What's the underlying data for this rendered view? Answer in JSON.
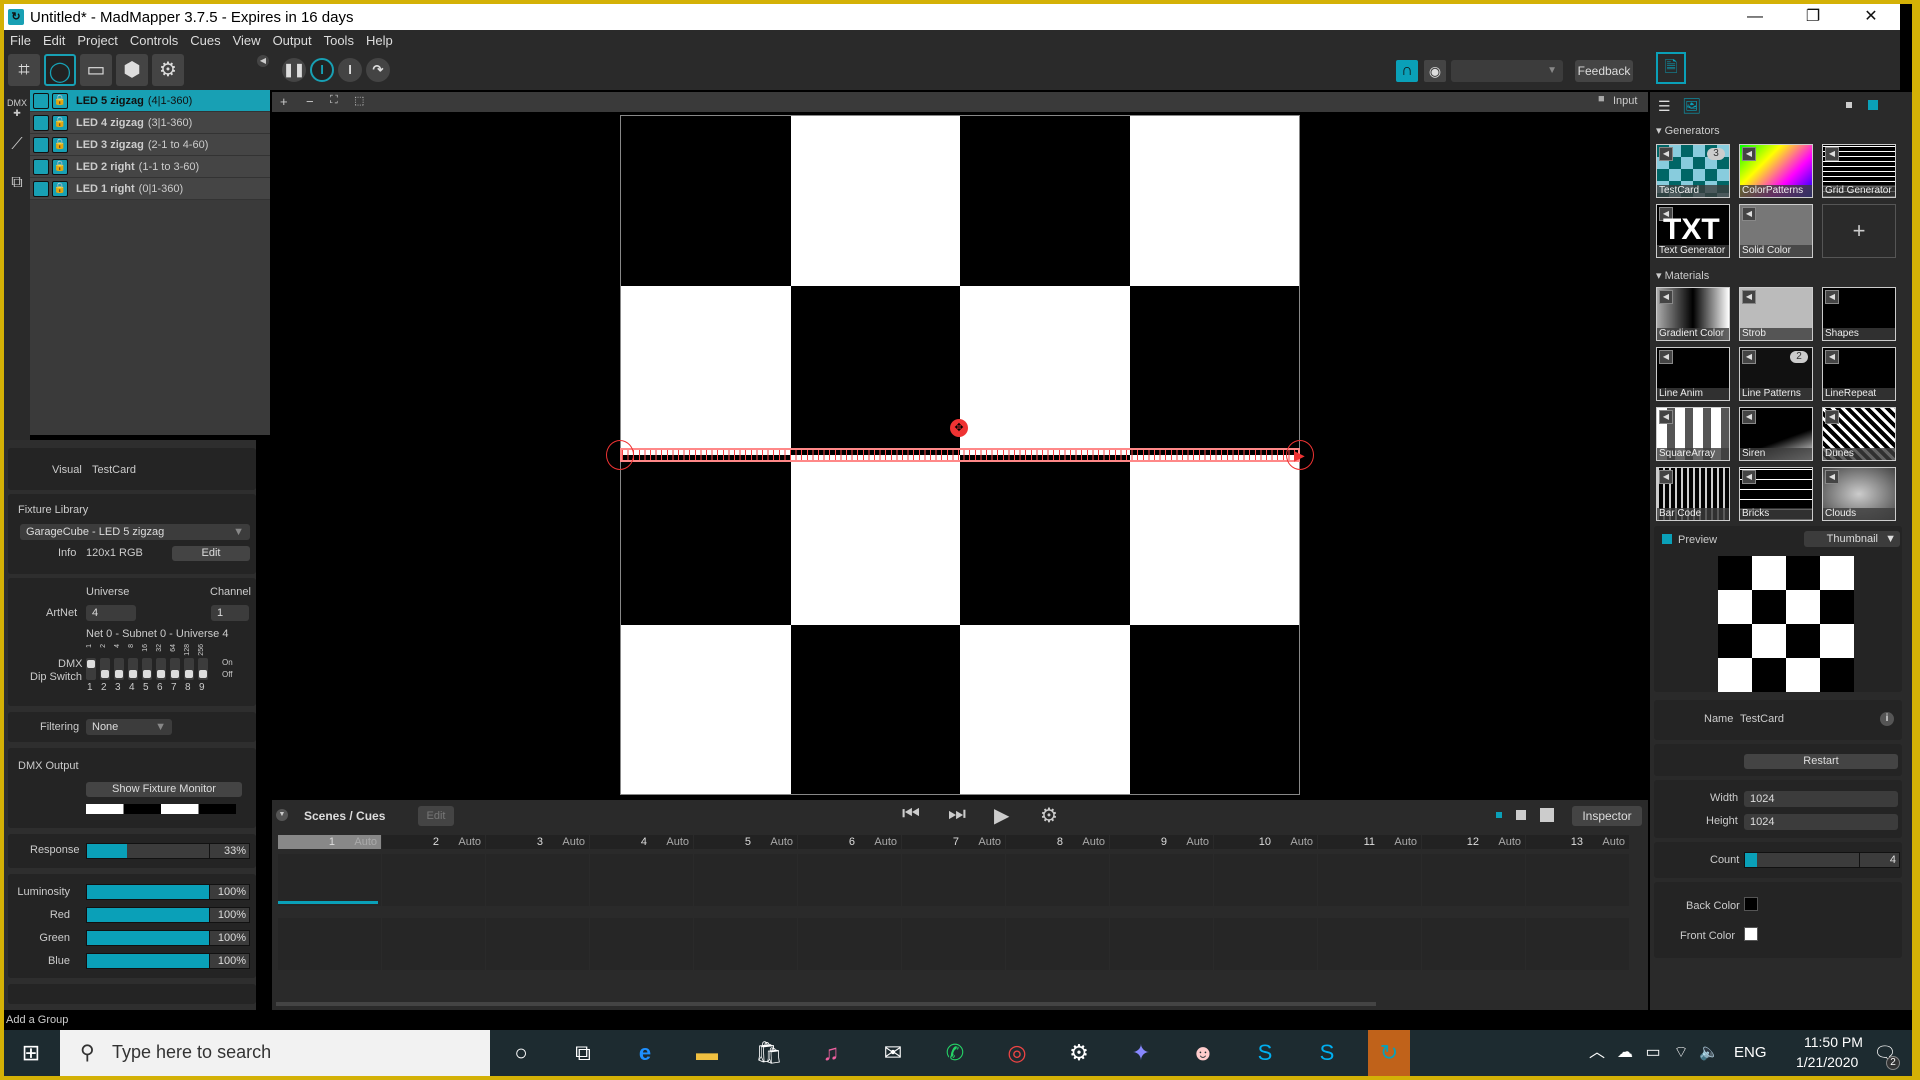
{
  "window": {
    "title": "Untitled* - MadMapper 3.7.5 - Expires in 16 days",
    "minimize": "—",
    "restore": "❐",
    "close": "✕"
  },
  "menu": [
    "File",
    "Edit",
    "Project",
    "Controls",
    "Cues",
    "View",
    "Output",
    "Tools",
    "Help"
  ],
  "toolbar": {
    "feedback_label": "Feedback",
    "input_label": "Input",
    "project_select_value": ""
  },
  "sidebar_tools": {
    "dmx_label": "DMX"
  },
  "layers": [
    {
      "name": "LED 5 zigzag",
      "detail": "(4|1-360)",
      "selected": true
    },
    {
      "name": "LED 4 zigzag",
      "detail": "(3|1-360)",
      "selected": false
    },
    {
      "name": "LED 3 zigzag",
      "detail": "(2-1 to 4-60)",
      "selected": false
    },
    {
      "name": "LED 2 right",
      "detail": "(1-1 to 3-60)",
      "selected": false
    },
    {
      "name": "LED 1 right",
      "detail": "(0|1-360)",
      "selected": false
    }
  ],
  "fixture": {
    "visual_label": "Visual",
    "visual_value": "TestCard",
    "library_label": "Fixture Library",
    "library_value": "GarageCube - LED 5 zigzag",
    "info_label": "Info",
    "info_value": "120x1 RGB",
    "edit_label": "Edit",
    "universe_label": "Universe",
    "channel_label": "Channel",
    "artnet_label": "ArtNet",
    "universe_value": "4",
    "channel_value": "1",
    "net_info": "Net 0 - Subnet 0 - Universe 4",
    "dmx_label": "DMX",
    "dip_label": "Dip Switch",
    "dip_values": [
      "1",
      "2",
      "4",
      "8",
      "16",
      "32",
      "64",
      "128",
      "256"
    ],
    "dip_numbers": [
      "1",
      "2",
      "3",
      "4",
      "5",
      "6",
      "7",
      "8",
      "9"
    ],
    "dip_on": [
      true,
      false,
      false,
      false,
      false,
      false,
      false,
      false,
      false
    ],
    "on_label": "On",
    "off_label": "Off",
    "filtering_label": "Filtering",
    "filtering_value": "None",
    "dmx_output_label": "DMX Output",
    "show_monitor_label": "Show Fixture Monitor",
    "response_label": "Response",
    "response_value": "33%",
    "response_fraction": 0.33,
    "color_sliders": [
      {
        "label": "Luminosity",
        "value": "100%",
        "fraction": 1.0
      },
      {
        "label": "Red",
        "value": "100%",
        "fraction": 1.0
      },
      {
        "label": "Green",
        "value": "100%",
        "fraction": 1.0
      },
      {
        "label": "Blue",
        "value": "100%",
        "fraction": 1.0
      }
    ],
    "add_group": "Add a Group"
  },
  "scenes": {
    "title": "Scenes / Cues",
    "edit_label": "Edit",
    "inspector_label": "Inspector",
    "cues": [
      {
        "n": "1",
        "mode": "Auto"
      },
      {
        "n": "2",
        "mode": "Auto"
      },
      {
        "n": "3",
        "mode": "Auto"
      },
      {
        "n": "4",
        "mode": "Auto"
      },
      {
        "n": "5",
        "mode": "Auto"
      },
      {
        "n": "6",
        "mode": "Auto"
      },
      {
        "n": "7",
        "mode": "Auto"
      },
      {
        "n": "8",
        "mode": "Auto"
      },
      {
        "n": "9",
        "mode": "Auto"
      },
      {
        "n": "10",
        "mode": "Auto"
      },
      {
        "n": "11",
        "mode": "Auto"
      },
      {
        "n": "12",
        "mode": "Auto"
      },
      {
        "n": "13",
        "mode": "Auto"
      }
    ]
  },
  "library": {
    "generators_label": "Generators",
    "generators": [
      {
        "name": "TestCard",
        "badge": "3"
      },
      {
        "name": "ColorPatterns",
        "badge": ""
      },
      {
        "name": "Grid Generator",
        "badge": ""
      },
      {
        "name": "Text Generator",
        "badge": ""
      },
      {
        "name": "Solid Color",
        "badge": ""
      }
    ],
    "add_label": "+",
    "materials_label": "Materials",
    "materials": [
      {
        "name": "Gradient Color",
        "badge": ""
      },
      {
        "name": "Strob",
        "badge": ""
      },
      {
        "name": "Shapes",
        "badge": ""
      },
      {
        "name": "Line Anim",
        "badge": ""
      },
      {
        "name": "Line Patterns",
        "badge": "2"
      },
      {
        "name": "LineRepeat",
        "badge": ""
      },
      {
        "name": "SquareArray",
        "badge": ""
      },
      {
        "name": "Siren",
        "badge": ""
      },
      {
        "name": "Dunes",
        "badge": ""
      },
      {
        "name": "Bar Code",
        "badge": ""
      },
      {
        "name": "Bricks",
        "badge": ""
      },
      {
        "name": "Clouds",
        "badge": ""
      }
    ]
  },
  "preview": {
    "label": "Preview",
    "mode": "Thumbnail"
  },
  "inspector": {
    "name_label": "Name",
    "name_value": "TestCard",
    "restart_label": "Restart",
    "width_label": "Width",
    "width_value": "1024",
    "height_label": "Height",
    "height_value": "1024",
    "count_label": "Count",
    "count_value": "4",
    "back_color_label": "Back Color",
    "back_color": "#000000",
    "front_color_label": "Front Color",
    "front_color": "#ffffff"
  },
  "taskbar": {
    "search_placeholder": "Type here to search",
    "lang": "ENG",
    "time": "11:50 PM",
    "date": "1/21/2020",
    "notifications": "2"
  },
  "colors": {
    "accent": "#0aa0b8",
    "led_overlay": "#ee3322"
  }
}
